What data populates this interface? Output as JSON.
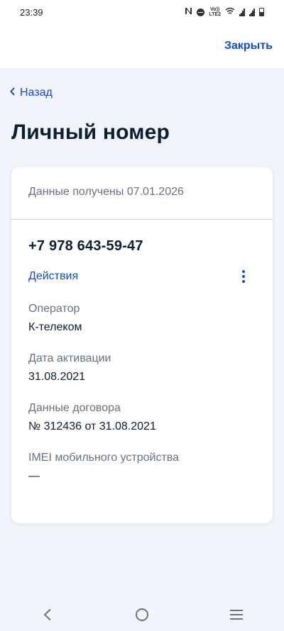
{
  "status_bar": {
    "time": "23:39",
    "icons": [
      "nfc-icon",
      "do-not-disturb-icon",
      "volte-icon",
      "wifi-icon",
      "signal-icon",
      "signal-icon",
      "battery-icon"
    ],
    "volte_label_top": "Vo))",
    "volte_label_bottom": "LTE2"
  },
  "header": {
    "close_label": "Закрыть"
  },
  "back_label": "Назад",
  "page_title": "Личный номер",
  "card": {
    "received_label": "Данные получены 07.01.2026",
    "phone": "+7 978 643-59-47",
    "actions_label": "Действия",
    "fields": [
      {
        "label": "Оператор",
        "value": "К-телеком"
      },
      {
        "label": "Дата активации",
        "value": "31.08.2021"
      },
      {
        "label": "Данные договора",
        "value": "№ 312436 от 31.08.2021"
      },
      {
        "label": "IMEI мобильного устройства",
        "value": "—"
      }
    ]
  },
  "colors": {
    "accent": "#0d4cd3",
    "text": "#0b1f33",
    "secondary_text": "#66727f",
    "background": "#f1f4fa"
  },
  "nav_bar": {
    "buttons": [
      "back-icon",
      "home-icon",
      "recents-icon"
    ]
  }
}
